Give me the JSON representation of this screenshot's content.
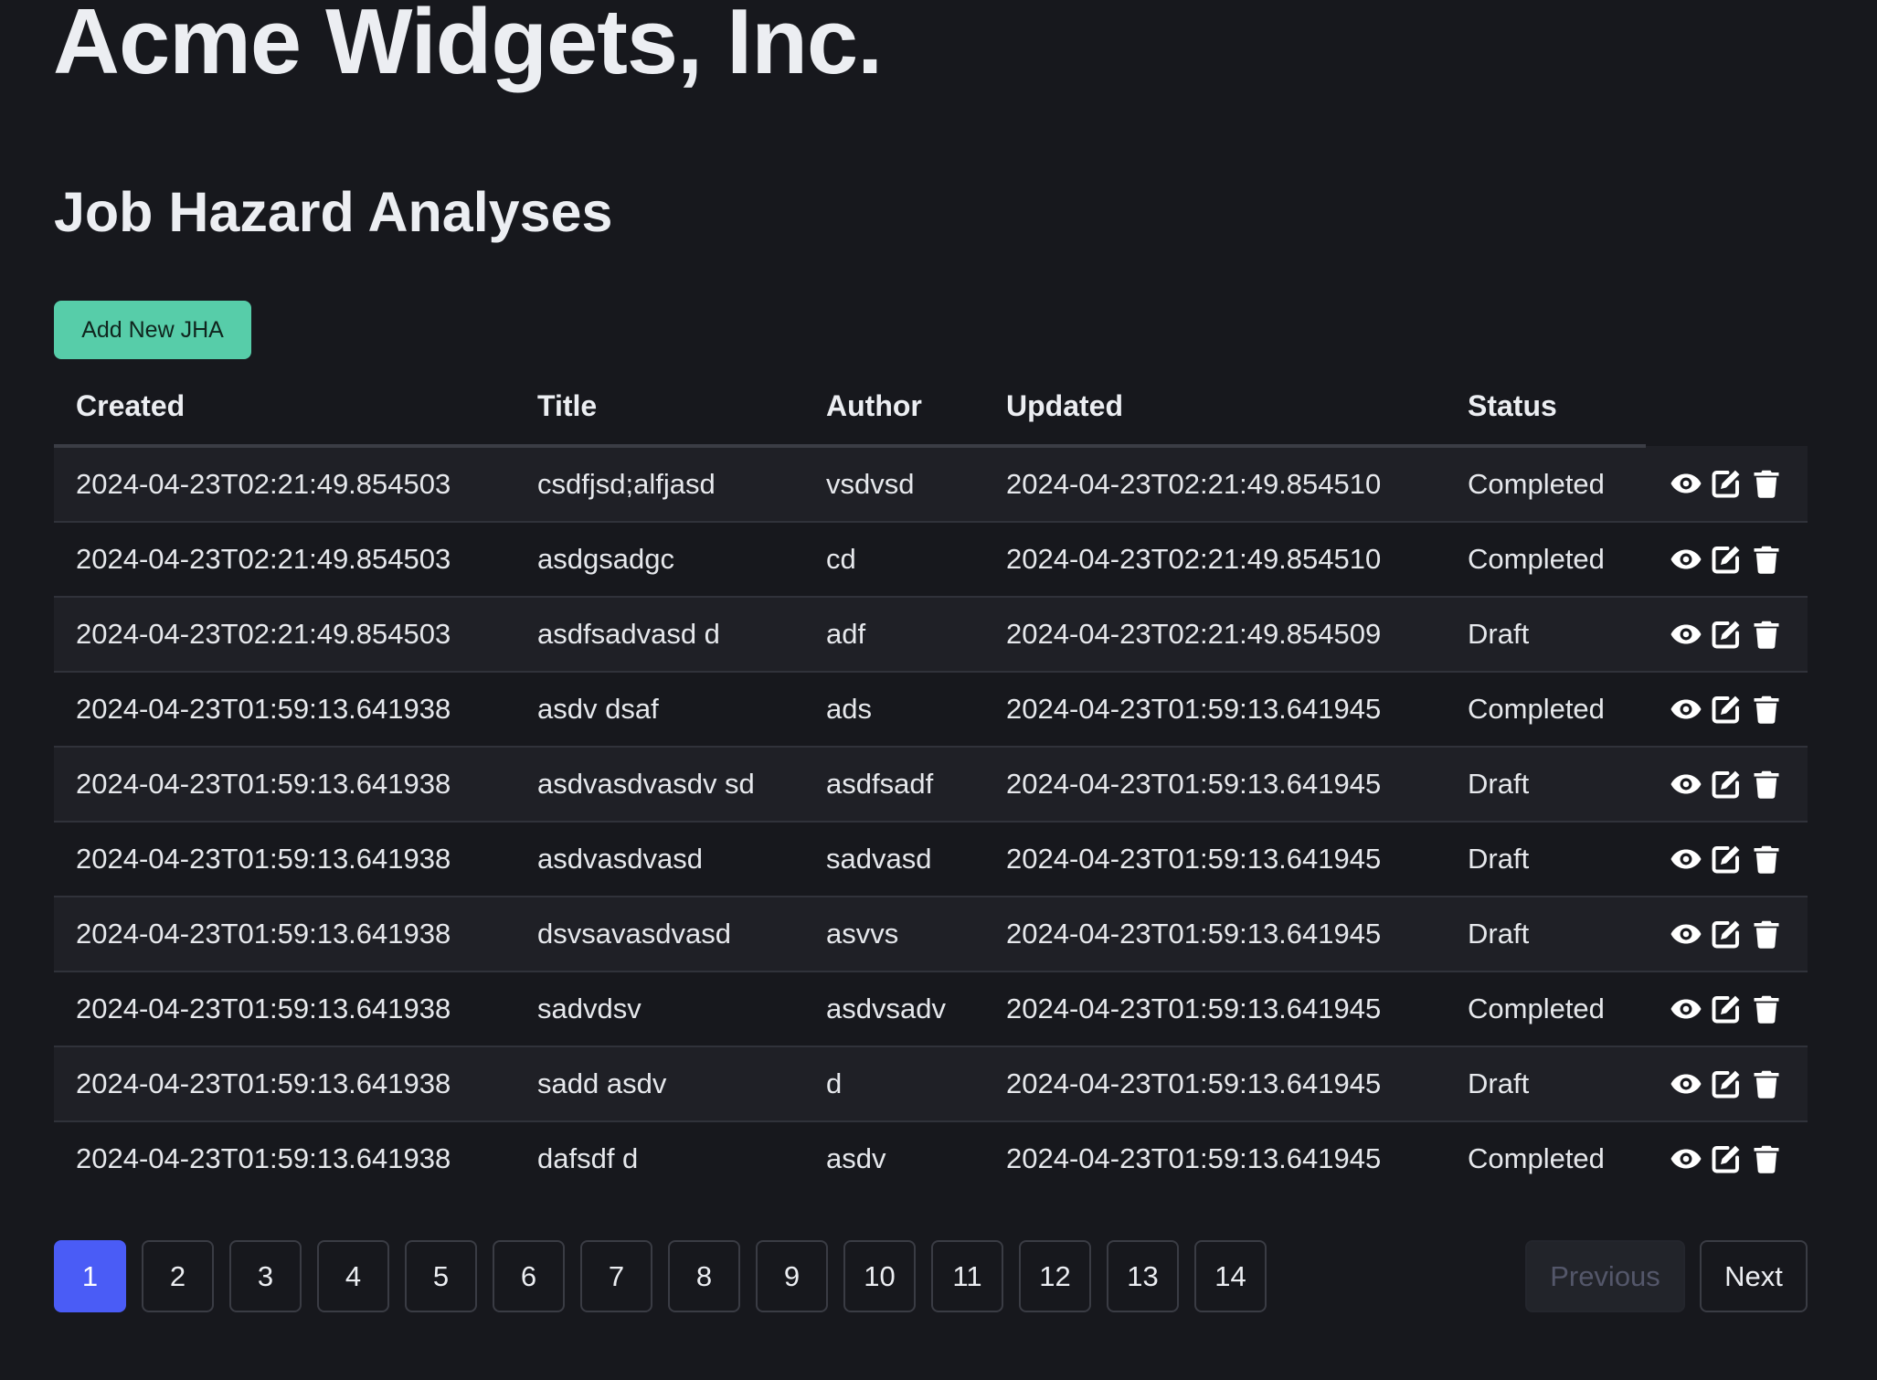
{
  "header": {
    "company": "Acme Widgets, Inc.",
    "page_title": "Job Hazard Analyses"
  },
  "toolbar": {
    "add_label": "Add New JHA"
  },
  "table": {
    "columns": [
      "Created",
      "Title",
      "Author",
      "Updated",
      "Status"
    ],
    "rows": [
      {
        "created": "2024-04-23T02:21:49.854503",
        "title": "csdfjsd;alfjasd",
        "author": "vsdvsd",
        "updated": "2024-04-23T02:21:49.854510",
        "status": "Completed"
      },
      {
        "created": "2024-04-23T02:21:49.854503",
        "title": "asdgsadgc",
        "author": "cd",
        "updated": "2024-04-23T02:21:49.854510",
        "status": "Completed"
      },
      {
        "created": "2024-04-23T02:21:49.854503",
        "title": "asdfsadvasd d",
        "author": "adf",
        "updated": "2024-04-23T02:21:49.854509",
        "status": "Draft"
      },
      {
        "created": "2024-04-23T01:59:13.641938",
        "title": "asdv dsaf",
        "author": "ads",
        "updated": "2024-04-23T01:59:13.641945",
        "status": "Completed"
      },
      {
        "created": "2024-04-23T01:59:13.641938",
        "title": "asdvasdvasdv sd",
        "author": "asdfsadf",
        "updated": "2024-04-23T01:59:13.641945",
        "status": "Draft"
      },
      {
        "created": "2024-04-23T01:59:13.641938",
        "title": "asdvasdvasd",
        "author": "sadvasd",
        "updated": "2024-04-23T01:59:13.641945",
        "status": "Draft"
      },
      {
        "created": "2024-04-23T01:59:13.641938",
        "title": "dsvsavasdvasd",
        "author": "asvvs",
        "updated": "2024-04-23T01:59:13.641945",
        "status": "Draft"
      },
      {
        "created": "2024-04-23T01:59:13.641938",
        "title": "sadvdsv",
        "author": "asdvsadv",
        "updated": "2024-04-23T01:59:13.641945",
        "status": "Completed"
      },
      {
        "created": "2024-04-23T01:59:13.641938",
        "title": "sadd asdv",
        "author": "d",
        "updated": "2024-04-23T01:59:13.641945",
        "status": "Draft"
      },
      {
        "created": "2024-04-23T01:59:13.641938",
        "title": "dafsdf d",
        "author": "asdv",
        "updated": "2024-04-23T01:59:13.641945",
        "status": "Completed"
      }
    ],
    "row_actions": [
      {
        "name": "view",
        "icon": "eye-icon"
      },
      {
        "name": "edit",
        "icon": "edit-icon"
      },
      {
        "name": "delete",
        "icon": "trash-icon"
      }
    ]
  },
  "pagination": {
    "pages": [
      "1",
      "2",
      "3",
      "4",
      "5",
      "6",
      "7",
      "8",
      "9",
      "10",
      "11",
      "12",
      "13",
      "14"
    ],
    "current": "1",
    "previous_label": "Previous",
    "next_label": "Next",
    "previous_disabled": true
  },
  "colors": {
    "background": "#17181d",
    "accent_button": "#57cda9",
    "active_page": "#4a5cf6"
  }
}
